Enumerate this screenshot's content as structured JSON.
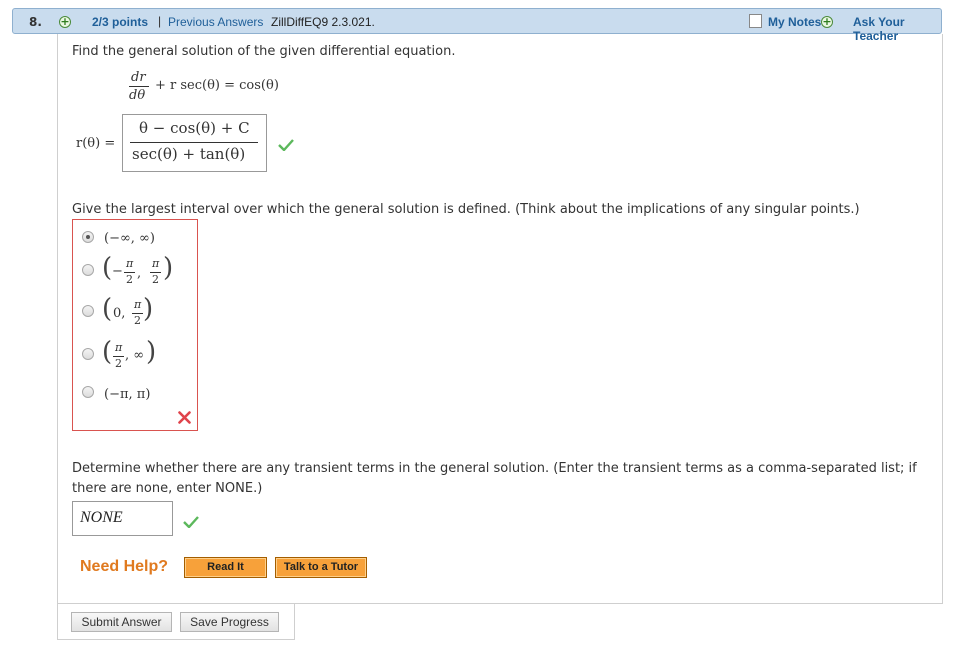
{
  "header": {
    "question_number": "8.",
    "points": "2/3 points",
    "separator": "|",
    "previous_answers": "Previous Answers",
    "question_id": "ZillDiffEQ9 2.3.021.",
    "my_notes": "My Notes",
    "ask_teacher": "Ask Your Teacher"
  },
  "question": {
    "prompt": "Find the general solution of the given differential equation.",
    "eq_num": "dr",
    "eq_den": "dθ",
    "eq_rest": "+ r sec(θ) = cos(θ)",
    "answer_label": "r(θ) =",
    "answer_num": "θ − cos(θ) + C",
    "answer_den": "sec(θ) + tan(θ)",
    "answer_status": "correct"
  },
  "interval": {
    "prompt": "Give the largest interval over which the general solution is defined. (Think about the implications of any singular points.)",
    "options": [
      {
        "text": "(−∞, ∞)",
        "selected": true
      },
      {
        "prefix": "−",
        "num": "π",
        "den": "2",
        "sep": ",",
        "num2": "π",
        "den2": "2",
        "selected": false
      },
      {
        "left": "0,",
        "num": "π",
        "den": "2",
        "selected": false
      },
      {
        "num": "π",
        "den": "2",
        "right": ", ∞",
        "selected": false
      },
      {
        "text": "(−π, π)",
        "selected": false
      }
    ],
    "status": "incorrect"
  },
  "transient": {
    "prompt_line1": "Determine whether there are any transient terms in the general solution. (Enter the transient terms as a comma-separated list; if",
    "prompt_line2": "there are none, enter NONE.)",
    "answer": "NONE",
    "status": "correct"
  },
  "help": {
    "label": "Need Help?",
    "read_it": "Read It",
    "talk_tutor": "Talk to a Tutor"
  },
  "footer": {
    "submit": "Submit Answer",
    "save": "Save Progress"
  },
  "colors": {
    "header_bg": "#c9dcee",
    "link": "#1f5f99",
    "help_orange": "#e07a1f",
    "error_red": "#d9534f",
    "correct_green": "#5cb85c"
  }
}
